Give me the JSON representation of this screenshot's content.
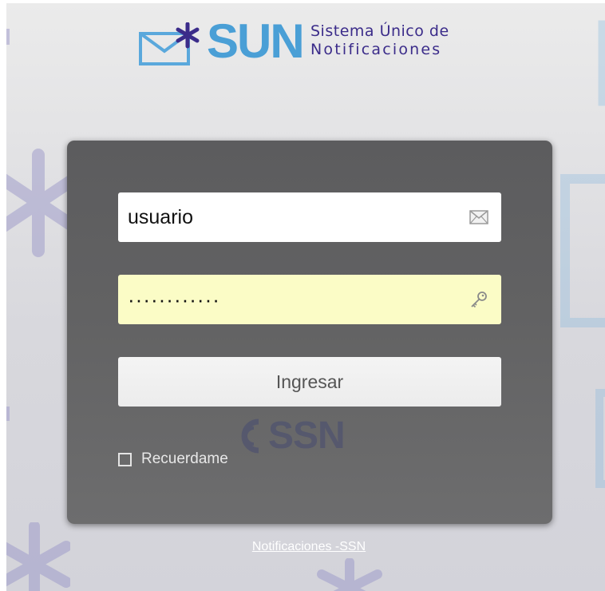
{
  "header": {
    "logo_text": "SUN",
    "tagline_line1": "Sistema Único de",
    "tagline_line2": "Notificaciones"
  },
  "login": {
    "username_value": "usuario",
    "password_value": "············",
    "submit_label": "Ingresar",
    "remember_label": "Recuerdame",
    "remember_checked": false
  },
  "watermark": {
    "text": "SSN"
  },
  "footer": {
    "link_label": "Notificaciones -SSN"
  },
  "colors": {
    "brand_blue": "#4a9fd6",
    "brand_purple": "#3b2c8a",
    "panel_bg": "#606061",
    "password_bg": "#fbfcc6"
  },
  "icons": {
    "username_field": "envelope-icon",
    "password_field": "key-icon"
  }
}
